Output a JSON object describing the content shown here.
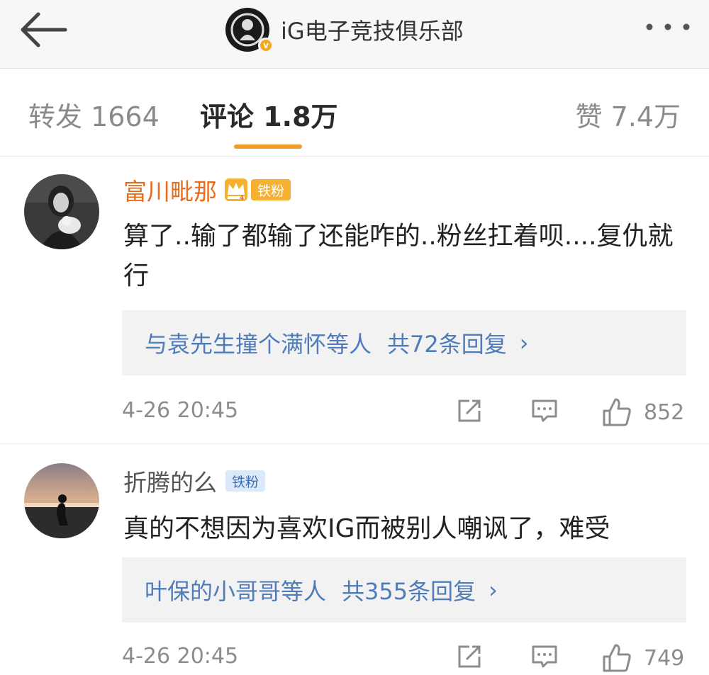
{
  "header": {
    "title": "iG电子竞技俱乐部",
    "verified_mark": "v"
  },
  "tabs": [
    {
      "label": "转发 1664"
    },
    {
      "label": "评论 1.8万",
      "active": true
    },
    {
      "label": "赞 7.4万"
    }
  ],
  "comments": [
    {
      "username": "富川毗那",
      "crown_level": "4",
      "fan_badge": "铁粉",
      "text": "算了..输了都输了还能咋的..粉丝扛着呗....复仇就行",
      "reply_users": "与袁先生撞个满怀等人",
      "reply_count": "共72条回复",
      "reply_chevron": "›",
      "time": "4-26 20:45",
      "likes": "852"
    },
    {
      "username": "折腾的么",
      "fan_badge": "铁粉",
      "text": "真的不想因为喜欢IG而被别人嘲讽了，难受",
      "reply_users": "叶保的小哥哥等人",
      "reply_count": "共355条回复",
      "reply_chevron": "›",
      "time": "4-26 20:45",
      "likes": "749"
    }
  ],
  "colors": {
    "accent_orange": "#f29a2a",
    "vip_name": "#e86c1a",
    "link_blue": "#4f7cb8",
    "badge_gold": "#f5b12f"
  },
  "icons": [
    "back-arrow-icon",
    "more-icon",
    "share-icon",
    "comment-icon",
    "like-icon",
    "crown-icon"
  ]
}
